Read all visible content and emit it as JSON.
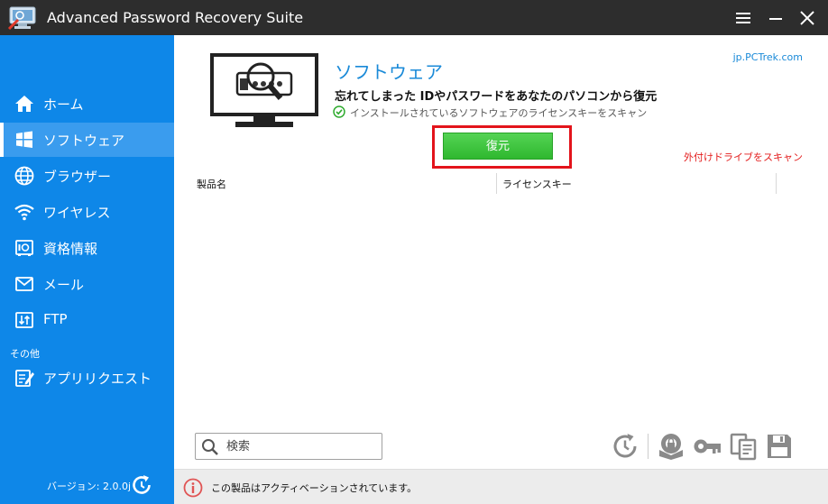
{
  "window": {
    "title": "Advanced Password Recovery Suite"
  },
  "sidebar": {
    "items": [
      {
        "label": "ホーム",
        "icon": "home-icon"
      },
      {
        "label": "ソフトウェア",
        "icon": "windows-icon",
        "active": true
      },
      {
        "label": "ブラウザー",
        "icon": "globe-icon"
      },
      {
        "label": "ワイヤレス",
        "icon": "wifi-icon"
      },
      {
        "label": "資格情報",
        "icon": "safe-icon"
      },
      {
        "label": "メール",
        "icon": "mail-icon"
      },
      {
        "label": "FTP",
        "icon": "ftp-icon"
      }
    ],
    "section_other": "その他",
    "extra_items": [
      {
        "label": "アプリリクエスト",
        "icon": "request-icon"
      }
    ],
    "version": "バージョン: 2.0.0j"
  },
  "main": {
    "heading": "ソフトウェア",
    "subheading": "忘れてしまった IDやパスワードをあなたのパソコンから復元",
    "check_text": "インストールされているソフトウェアのライセンスキーをスキャン",
    "site_link": "jp.PCTrek.com",
    "recover_button": "復元",
    "scan_link": "外付けドライブをスキャン",
    "table": {
      "columns": [
        "製品名",
        "ライセンスキー"
      ],
      "rows": []
    },
    "search": {
      "placeholder": "検索"
    }
  },
  "status": {
    "text": "この製品はアクティベーションされています。"
  },
  "colors": {
    "sidebar": "#0e87e8",
    "sidebar_active": "#3a9cee",
    "titlebar": "#2d2d2d",
    "accent": "#1a8ad8",
    "recover_green": "#3cc43c",
    "highlight_red": "#e3141b"
  }
}
